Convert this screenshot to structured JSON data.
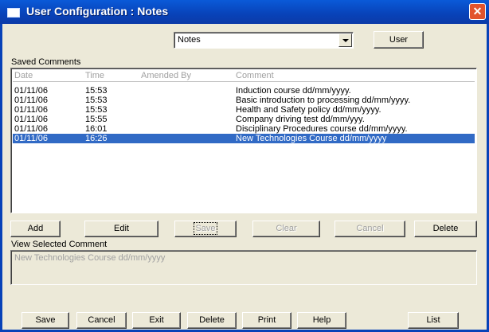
{
  "window": {
    "title": "User Configuration : Notes",
    "close_glyph": "✕"
  },
  "top": {
    "combo_value": "Notes",
    "user_button": "User"
  },
  "saved_comments": {
    "label": "Saved Comments",
    "columns": [
      "Date",
      "Time",
      "Amended By",
      "Comment"
    ],
    "rows": [
      {
        "date": "01/11/06",
        "time": "15:53",
        "amended_by": "",
        "comment": "Induction course dd/mm/yyyy."
      },
      {
        "date": "01/11/06",
        "time": "15:53",
        "amended_by": "",
        "comment": "Basic introduction to processing dd/mm/yyyy."
      },
      {
        "date": "01/11/06",
        "time": "15:53",
        "amended_by": "",
        "comment": "Health and Safety policy dd/mm/yyyy."
      },
      {
        "date": "01/11/06",
        "time": "15:55",
        "amended_by": "",
        "comment": "Company driving test dd/mm/yyy."
      },
      {
        "date": "01/11/06",
        "time": "16:01",
        "amended_by": "",
        "comment": "Disciplinary Procedures course dd/mm/yyyy."
      },
      {
        "date": "01/11/06",
        "time": "16:26",
        "amended_by": "",
        "comment": "New Technologies Course dd/mm/yyyy"
      }
    ],
    "selected_row": 5
  },
  "comment_buttons": {
    "add": "Add",
    "edit": "Edit",
    "save": "Save",
    "clear": "Clear",
    "cancel": "Cancel",
    "delete": "Delete"
  },
  "view_selected": {
    "label": "View Selected Comment",
    "text": "New Technologies Course dd/mm/yyyy"
  },
  "bottom_buttons": {
    "save": "Save",
    "cancel": "Cancel",
    "exit": "Exit",
    "delete": "Delete",
    "print": "Print",
    "help": "Help",
    "list": "List"
  },
  "colors": {
    "title_bar": "#0842b8",
    "selection": "#316ac5",
    "face": "#ece9d8",
    "close_button": "#e2532d"
  }
}
